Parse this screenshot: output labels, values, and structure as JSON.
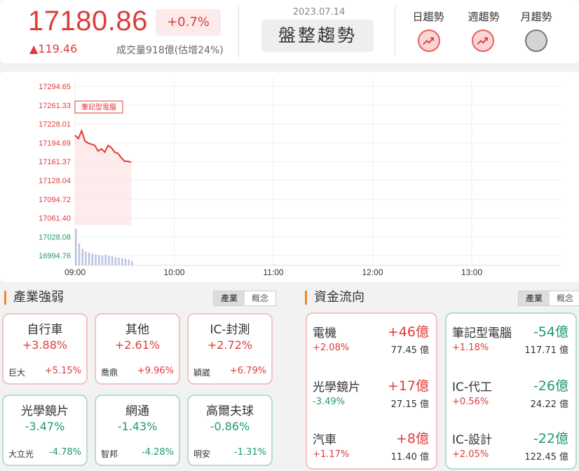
{
  "header": {
    "price": "17180.86",
    "percent": "+0.7%",
    "change": "▲119.46",
    "volume": "成交量918億(估增24%)",
    "date": "2023.07.14",
    "trend": "盤整趨勢",
    "trend_labels": {
      "day": "日趨勢",
      "week": "週趨勢",
      "month": "月趨勢"
    },
    "trend_states": {
      "day": "up",
      "week": "up",
      "month": "neutral"
    },
    "colors": {
      "up": "#e03b3b",
      "down": "#1e9b6b",
      "accent": "#f08a28"
    }
  },
  "chart": {
    "annotation": "筆記型電腦",
    "y_ticks_red": [
      "17294.65",
      "17261.33",
      "17228.01",
      "17194.69",
      "17161.37",
      "17128.04",
      "17094.72",
      "17061.40"
    ],
    "y_ticks_green": [
      "17028.08",
      "16994.76"
    ],
    "x_ticks": [
      "09:00",
      "10:00",
      "11:00",
      "12:00",
      "13:00"
    ]
  },
  "chart_data": {
    "type": "line",
    "ylim": [
      16994.76,
      17294.65
    ],
    "x_range_minutes": [
      0,
      270
    ],
    "price": {
      "x": [
        0,
        2,
        4,
        6,
        8,
        10,
        12,
        14,
        16,
        18,
        20,
        22,
        24,
        26,
        28,
        30,
        32,
        34
      ],
      "values": [
        17208,
        17202,
        17216,
        17198,
        17194,
        17192,
        17190,
        17180,
        17184,
        17178,
        17190,
        17186,
        17178,
        17176,
        17168,
        17162,
        17162,
        17160
      ]
    },
    "volume": {
      "x": [
        0,
        2,
        4,
        6,
        8,
        10,
        12,
        14,
        16,
        18,
        20,
        22,
        24,
        26,
        28,
        30,
        32,
        34
      ],
      "values": [
        100,
        60,
        45,
        38,
        35,
        32,
        30,
        28,
        27,
        30,
        26,
        25,
        22,
        21,
        20,
        18,
        16,
        12
      ]
    }
  },
  "industry": {
    "title": "產業強弱",
    "tabs": [
      "產業",
      "概念"
    ],
    "items": [
      {
        "name": "自行車",
        "pct": "+3.88%",
        "stock": "巨大",
        "stock_pct": "+5.15%",
        "dir": "up"
      },
      {
        "name": "其他",
        "pct": "+2.61%",
        "stock": "喬鼎",
        "stock_pct": "+9.96%",
        "dir": "up"
      },
      {
        "name": "IC-封測",
        "pct": "+2.72%",
        "stock": "穎崴",
        "stock_pct": "+6.79%",
        "dir": "up"
      },
      {
        "name": "光學鏡片",
        "pct": "-3.47%",
        "stock": "大立光",
        "stock_pct": "-4.78%",
        "dir": "down"
      },
      {
        "name": "網通",
        "pct": "-1.43%",
        "stock": "智邦",
        "stock_pct": "-4.28%",
        "dir": "down"
      },
      {
        "name": "高爾夫球",
        "pct": "-0.86%",
        "stock": "明安",
        "stock_pct": "-1.31%",
        "dir": "down"
      }
    ]
  },
  "flow": {
    "title": "資金流向",
    "tabs": [
      "產業",
      "概念"
    ],
    "left": [
      {
        "name": "電機",
        "amount": "+46億",
        "pct": "+2.08%",
        "value": "77.45 億",
        "dir": "up",
        "pct_dir": "up"
      },
      {
        "name": "光學鏡片",
        "amount": "+17億",
        "pct": "-3.49%",
        "value": "27.15 億",
        "dir": "up",
        "pct_dir": "down"
      },
      {
        "name": "汽車",
        "amount": "+8億",
        "pct": "+1.17%",
        "value": "11.40 億",
        "dir": "up",
        "pct_dir": "up"
      }
    ],
    "right": [
      {
        "name": "筆記型電腦",
        "amount": "-54億",
        "pct": "+1.18%",
        "value": "117.71 億",
        "dir": "down",
        "pct_dir": "up"
      },
      {
        "name": "IC-代工",
        "amount": "-26億",
        "pct": "+0.56%",
        "value": "24.22 億",
        "dir": "down",
        "pct_dir": "up"
      },
      {
        "name": "IC-設計",
        "amount": "-22億",
        "pct": "+2.05%",
        "value": "122.45 億",
        "dir": "down",
        "pct_dir": "up"
      }
    ]
  }
}
